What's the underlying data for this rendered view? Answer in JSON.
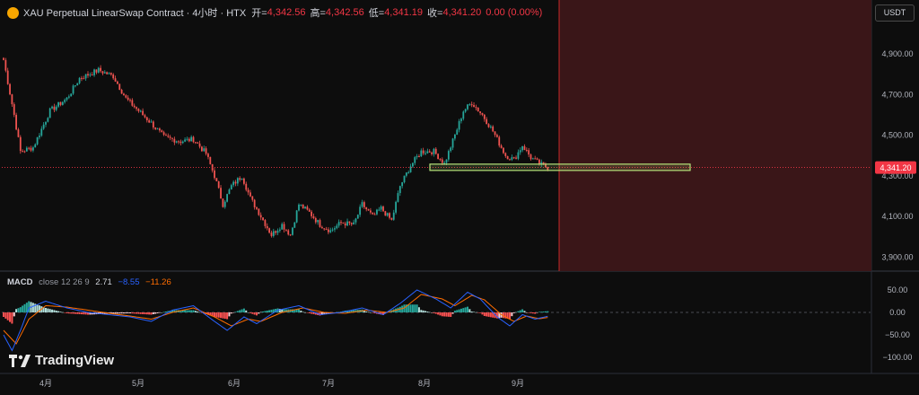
{
  "header": {
    "title": "XAU Perpetual LinearSwap Contract · 4小时 · HTX",
    "open_label": "开=",
    "open": "4,342.56",
    "high_label": "高=",
    "high": "4,342.56",
    "low_label": "低=",
    "low": "4,341.19",
    "close_label": "收=",
    "close": "4,341.20",
    "change": "0.00 (0.00%)"
  },
  "unit": "USDT",
  "macd": {
    "name": "MACD",
    "params": "close 12 26 9",
    "histogram": "2.71",
    "macd": "−8.55",
    "signal": "−11.26"
  },
  "branding": "TradingView",
  "colors": {
    "up": "#26a69a",
    "down": "#ef5350",
    "macd_line": "#2962ff",
    "signal_line": "#ff6d00",
    "zone_fill": "#3a1618",
    "zone_border": "#c62828",
    "box": "#b5e37a",
    "price_tag": "#f23645"
  },
  "chart_data": [
    {
      "type": "candlestick",
      "x_ticks": [
        "4月",
        "5月",
        "6月",
        "7月",
        "8月",
        "9月"
      ],
      "y_ticks": [
        "4,900.00",
        "4,700.00",
        "4,500.00",
        "4,300.00",
        "4,100.00",
        "3,900.00"
      ],
      "ylim": [
        3900,
        4900
      ],
      "last_price": "4,341.20",
      "path": [
        [
          0,
          4870
        ],
        [
          5,
          4600
        ],
        [
          8,
          4420
        ],
        [
          14,
          4440
        ],
        [
          22,
          4620
        ],
        [
          30,
          4680
        ],
        [
          36,
          4780
        ],
        [
          45,
          4820
        ],
        [
          52,
          4790
        ],
        [
          58,
          4680
        ],
        [
          66,
          4600
        ],
        [
          70,
          4560
        ],
        [
          76,
          4490
        ],
        [
          84,
          4470
        ],
        [
          90,
          4480
        ],
        [
          96,
          4410
        ],
        [
          100,
          4300
        ],
        [
          104,
          4160
        ],
        [
          108,
          4250
        ],
        [
          113,
          4300
        ],
        [
          117,
          4190
        ],
        [
          121,
          4120
        ],
        [
          127,
          4010
        ],
        [
          132,
          4060
        ],
        [
          136,
          4010
        ],
        [
          140,
          4160
        ],
        [
          145,
          4120
        ],
        [
          150,
          4060
        ],
        [
          155,
          4030
        ],
        [
          160,
          4070
        ],
        [
          166,
          4060
        ],
        [
          170,
          4160
        ],
        [
          175,
          4100
        ],
        [
          179,
          4140
        ],
        [
          184,
          4080
        ],
        [
          188,
          4250
        ],
        [
          193,
          4350
        ],
        [
          198,
          4420
        ],
        [
          204,
          4420
        ],
        [
          209,
          4360
        ],
        [
          214,
          4500
        ],
        [
          218,
          4620
        ],
        [
          222,
          4660
        ],
        [
          227,
          4600
        ],
        [
          232,
          4520
        ],
        [
          238,
          4400
        ],
        [
          242,
          4380
        ],
        [
          246,
          4450
        ],
        [
          250,
          4390
        ],
        [
          254,
          4360
        ],
        [
          258,
          4341
        ]
      ]
    },
    {
      "type": "bar",
      "title": "MACD",
      "y_ticks": [
        "50.00",
        "0.00",
        "−50.00",
        "−100.00"
      ],
      "ylim": [
        -100,
        50
      ],
      "macd_path": [
        [
          0,
          -50
        ],
        [
          4,
          -85
        ],
        [
          8,
          -40
        ],
        [
          12,
          10
        ],
        [
          20,
          25
        ],
        [
          30,
          10
        ],
        [
          40,
          0
        ],
        [
          50,
          -5
        ],
        [
          60,
          -10
        ],
        [
          70,
          -20
        ],
        [
          80,
          5
        ],
        [
          90,
          15
        ],
        [
          100,
          -20
        ],
        [
          106,
          -40
        ],
        [
          114,
          -10
        ],
        [
          120,
          -25
        ],
        [
          130,
          5
        ],
        [
          140,
          15
        ],
        [
          150,
          -5
        ],
        [
          160,
          0
        ],
        [
          170,
          10
        ],
        [
          180,
          -5
        ],
        [
          188,
          20
        ],
        [
          196,
          50
        ],
        [
          205,
          30
        ],
        [
          212,
          10
        ],
        [
          220,
          45
        ],
        [
          226,
          30
        ],
        [
          234,
          -10
        ],
        [
          240,
          -30
        ],
        [
          246,
          -5
        ],
        [
          252,
          -15
        ],
        [
          258,
          -8.55
        ]
      ],
      "signal_path": [
        [
          0,
          -40
        ],
        [
          6,
          -70
        ],
        [
          12,
          -15
        ],
        [
          20,
          15
        ],
        [
          30,
          12
        ],
        [
          40,
          5
        ],
        [
          50,
          -2
        ],
        [
          60,
          -8
        ],
        [
          70,
          -15
        ],
        [
          80,
          0
        ],
        [
          90,
          10
        ],
        [
          100,
          -10
        ],
        [
          108,
          -30
        ],
        [
          116,
          -15
        ],
        [
          122,
          -20
        ],
        [
          132,
          0
        ],
        [
          142,
          10
        ],
        [
          152,
          0
        ],
        [
          162,
          -2
        ],
        [
          172,
          5
        ],
        [
          182,
          0
        ],
        [
          190,
          10
        ],
        [
          198,
          40
        ],
        [
          208,
          30
        ],
        [
          214,
          15
        ],
        [
          222,
          38
        ],
        [
          228,
          28
        ],
        [
          236,
          -5
        ],
        [
          242,
          -20
        ],
        [
          248,
          -8
        ],
        [
          254,
          -14
        ],
        [
          258,
          -11.26
        ]
      ],
      "last": {
        "histogram": 2.71,
        "macd": -8.55,
        "signal": -11.26
      }
    }
  ]
}
